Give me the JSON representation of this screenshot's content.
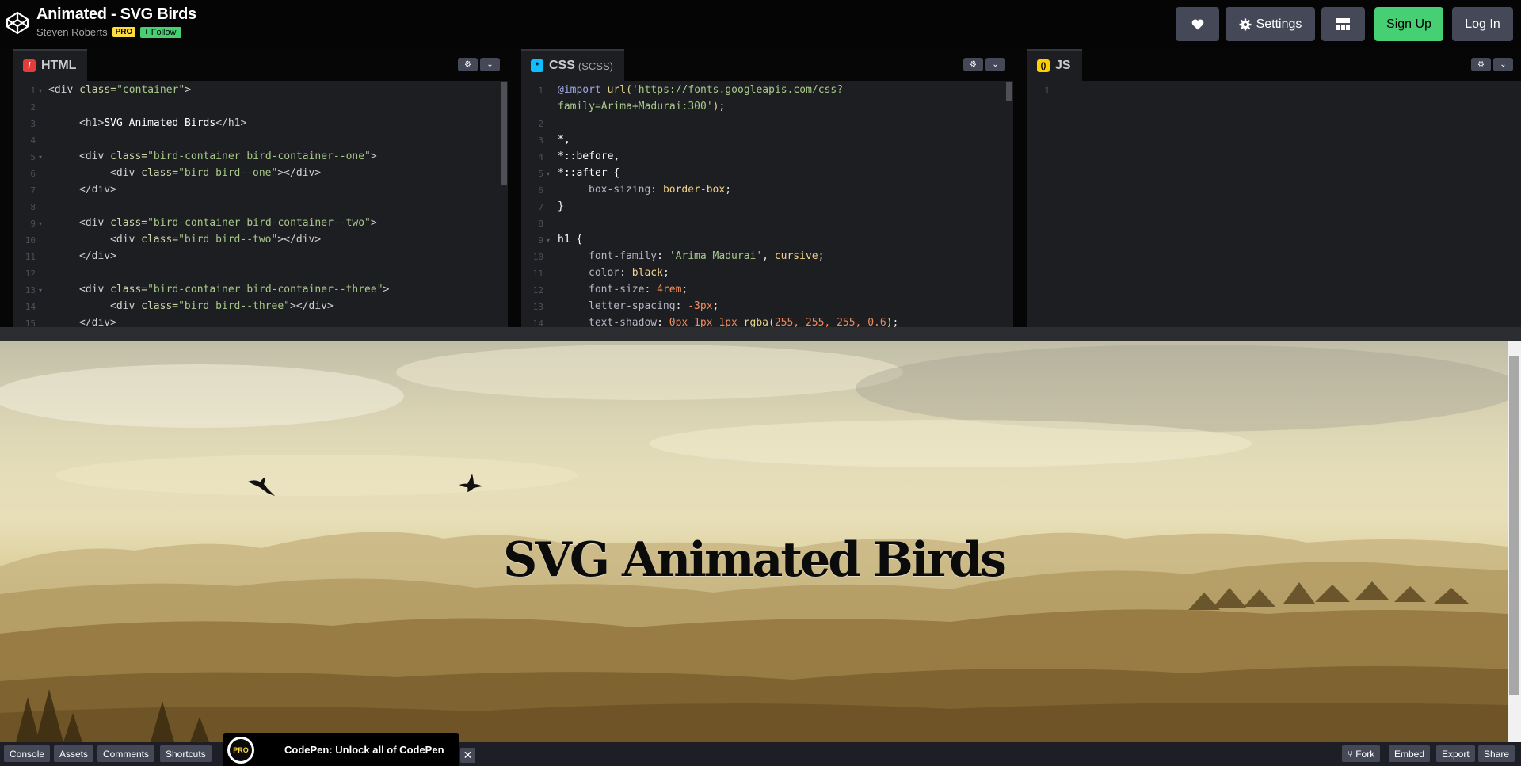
{
  "header": {
    "title": "Animated - SVG Birds",
    "author": "Steven Roberts",
    "pro_badge": "PRO",
    "follow_label": "Follow",
    "settings_label": "Settings",
    "signup_label": "Sign Up",
    "login_label": "Log In"
  },
  "editors": {
    "html": {
      "label": "HTML"
    },
    "css": {
      "label": "CSS",
      "sublabel": "(SCSS)"
    },
    "js": {
      "label": "JS",
      "line_number": "1"
    }
  },
  "preview": {
    "heading": "SVG Animated Birds"
  },
  "bottombar": {
    "left_buttons": [
      "Console",
      "Assets",
      "Comments",
      "Shortcuts"
    ],
    "right_buttons": [
      "Fork",
      "Embed",
      "Export",
      "Share"
    ],
    "promo_badge": "PRO",
    "promo_text": "CodePen: Unlock all of CodePen",
    "close_glyph": "✕"
  },
  "colors": {
    "accent_green": "#47cf73",
    "pro_yellow": "#ffdd40",
    "button_gray": "#444857",
    "editor_bg": "#1d1e22"
  }
}
